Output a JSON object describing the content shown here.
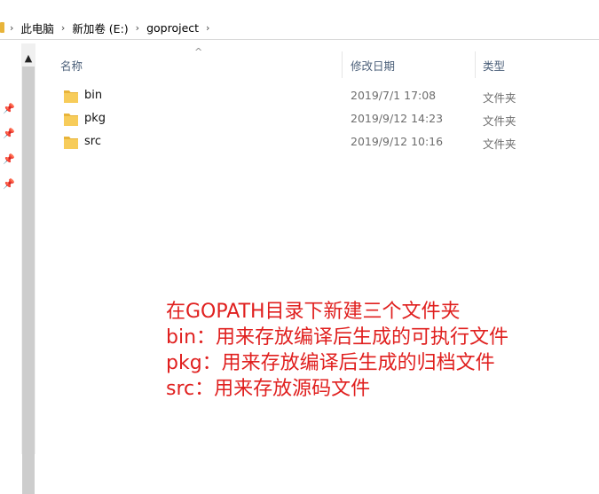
{
  "breadcrumb": [
    "此电脑",
    "新加卷 (E:)",
    "goproject"
  ],
  "columns": {
    "name": "名称",
    "modified": "修改日期",
    "type": "类型"
  },
  "files": [
    {
      "name": "bin",
      "modified": "2019/7/1 17:08",
      "type": "文件夹"
    },
    {
      "name": "pkg",
      "modified": "2019/9/12 14:23",
      "type": "文件夹"
    },
    {
      "name": "src",
      "modified": "2019/9/12 10:16",
      "type": "文件夹"
    }
  ],
  "annotation": [
    "在GOPATH目录下新建三个文件夹",
    "bin：用来存放编译后生成的可执行文件",
    "pkg：用来存放编译后生成的归档文件",
    "src：用来存放源码文件"
  ],
  "colors": {
    "folder": "#e8b43a",
    "annotation": "#e0201f"
  }
}
